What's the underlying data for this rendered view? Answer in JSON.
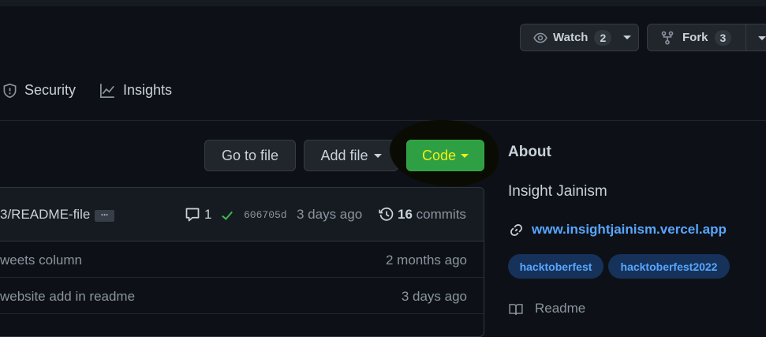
{
  "header": {
    "watch": {
      "label": "Watch",
      "count": "2"
    },
    "fork": {
      "label": "Fork",
      "count": "3"
    }
  },
  "tabs": [
    {
      "label": "Security",
      "icon": "shield-icon"
    },
    {
      "label": "Insights",
      "icon": "graph-icon"
    }
  ],
  "actions": {
    "go_to_file": "Go to file",
    "add_file": "Add file",
    "code": "Code"
  },
  "latest_commit": {
    "message": "3/README-file",
    "ellipsis": "...",
    "comments": "1",
    "sha": "606705d",
    "time": "3 days ago",
    "commit_count": "16",
    "commits_label": "commits"
  },
  "files": [
    {
      "message": "weets column",
      "time": "2 months ago"
    },
    {
      "message": "website add in readme",
      "time": "3 days ago"
    }
  ],
  "about": {
    "heading": "About",
    "description": "Insight Jainism",
    "link": "www.insightjainism.vercel.app",
    "topics": [
      "hacktoberfest",
      "hacktoberfest2022"
    ],
    "readme_label": "Readme"
  },
  "colors": {
    "background": "#0d1117",
    "code_button": "#2ea043",
    "code_text": "#f0f01a",
    "link": "#58a6ff",
    "check": "#3fb950"
  }
}
